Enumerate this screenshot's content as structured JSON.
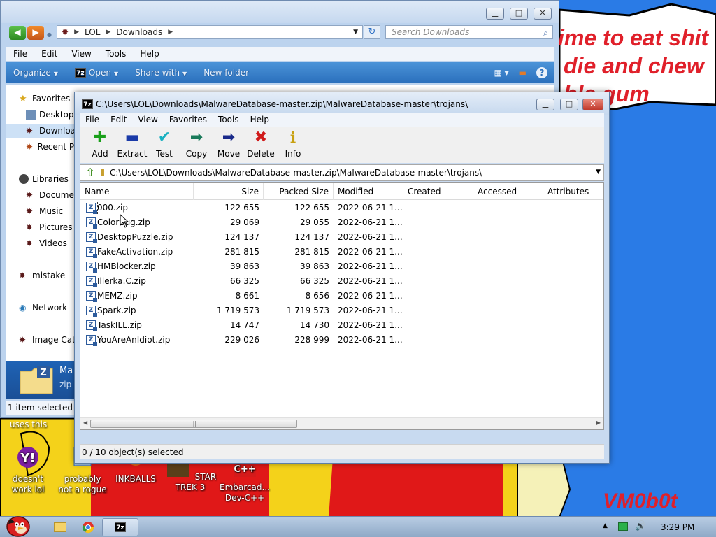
{
  "wallpaper": {
    "lines": [
      "ime to eat shit",
      "die and chew",
      "ble gum"
    ],
    "logo": "VM0b0t",
    "uses_this": "uses this"
  },
  "desktop_icons": [
    {
      "label": "doesn't work lol"
    },
    {
      "label": "probably not a rogue"
    },
    {
      "label": "INKBALLS"
    },
    {
      "label": "STAR TREK 3"
    },
    {
      "label": "Embarcad... Dev-C++"
    }
  ],
  "explorer": {
    "breadcrumb": [
      "LOL",
      "Downloads"
    ],
    "search_placeholder": "Search Downloads",
    "menu": [
      "File",
      "Edit",
      "View",
      "Tools",
      "Help"
    ],
    "commands": [
      "Organize",
      "Open",
      "Share with",
      "New folder"
    ],
    "nav": {
      "favorites": "Favorites",
      "desktop": "Desktop",
      "downloads": "Downloads",
      "recent": "Recent Places",
      "libraries": "Libraries",
      "documents": "Documents",
      "music": "Music",
      "pictures": "Pictures",
      "videos": "Videos",
      "mistake": "mistake",
      "network": "Network",
      "image_cat": "Image Cat"
    },
    "details": {
      "name": "Ma",
      "type": "zip"
    },
    "status": "1 item selected"
  },
  "zip": {
    "title": "C:\\Users\\LOL\\Downloads\\MalwareDatabase-master.zip\\MalwareDatabase-master\\trojans\\",
    "menu": [
      "File",
      "Edit",
      "View",
      "Favorites",
      "Tools",
      "Help"
    ],
    "toolbar": [
      {
        "label": "Add"
      },
      {
        "label": "Extract"
      },
      {
        "label": "Test"
      },
      {
        "label": "Copy"
      },
      {
        "label": "Move"
      },
      {
        "label": "Delete"
      },
      {
        "label": "Info"
      }
    ],
    "path": "C:\\Users\\LOL\\Downloads\\MalwareDatabase-master.zip\\MalwareDatabase-master\\trojans\\",
    "columns": [
      "Name",
      "Size",
      "Packed Size",
      "Modified",
      "Created",
      "Accessed",
      "Attributes"
    ],
    "files": [
      {
        "name": "000.zip",
        "size": "122 655",
        "packed": "122 655",
        "modified": "2022-06-21 1..."
      },
      {
        "name": "ColorBug.zip",
        "size": "29 069",
        "packed": "29 055",
        "modified": "2022-06-21 1..."
      },
      {
        "name": "DesktopPuzzle.zip",
        "size": "124 137",
        "packed": "124 137",
        "modified": "2022-06-21 1..."
      },
      {
        "name": "FakeActivation.zip",
        "size": "281 815",
        "packed": "281 815",
        "modified": "2022-06-21 1..."
      },
      {
        "name": "HMBlocker.zip",
        "size": "39 863",
        "packed": "39 863",
        "modified": "2022-06-21 1..."
      },
      {
        "name": "Illerka.C.zip",
        "size": "66 325",
        "packed": "66 325",
        "modified": "2022-06-21 1..."
      },
      {
        "name": "MEMZ.zip",
        "size": "8 661",
        "packed": "8 656",
        "modified": "2022-06-21 1..."
      },
      {
        "name": "Spark.zip",
        "size": "1 719 573",
        "packed": "1 719 573",
        "modified": "2022-06-21 1..."
      },
      {
        "name": "TaskILL.zip",
        "size": "14 747",
        "packed": "14 730",
        "modified": "2022-06-21 1..."
      },
      {
        "name": "YouAreAnIdiot.zip",
        "size": "229 026",
        "packed": "228 999",
        "modified": "2022-06-21 1..."
      }
    ],
    "status": "0 / 10 object(s) selected"
  },
  "taskbar": {
    "clock": "3:29 PM"
  }
}
